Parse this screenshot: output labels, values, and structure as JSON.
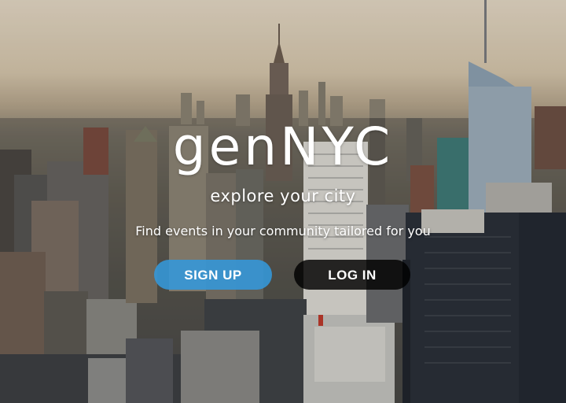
{
  "brand": {
    "logo": "genNYC"
  },
  "hero": {
    "tagline": "explore your city",
    "subtitle": "Find events in your community tailored for you"
  },
  "actions": {
    "signup_label": "SIGN UP",
    "login_label": "LOG IN"
  },
  "colors": {
    "signup": "#3498db",
    "login": "#000000",
    "text": "#ffffff"
  }
}
